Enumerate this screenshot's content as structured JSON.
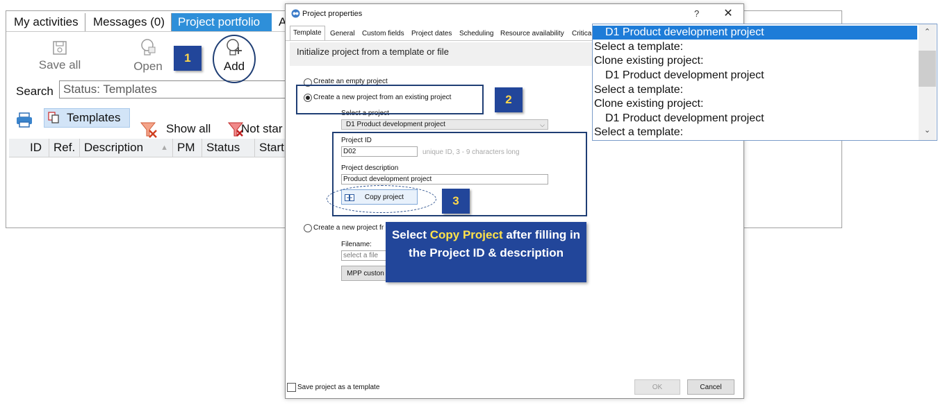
{
  "app": {
    "tabs": [
      "My activities",
      "Messages (0)",
      "Project portfolio",
      "A"
    ],
    "toolbar": {
      "save_all": "Save all",
      "open": "Open",
      "add": "Add"
    },
    "search": {
      "label": "Search",
      "value": "Status: Templates"
    },
    "filters": {
      "templates": "Templates",
      "show_all": "Show all",
      "not_started": "Not star"
    },
    "columns": [
      "ID",
      "Ref.",
      "Description",
      "PM",
      "Status",
      "Start"
    ]
  },
  "dialog": {
    "title": "Project properties",
    "help": "?",
    "close": "✕",
    "tabs": [
      "Template",
      "General",
      "Custom fields",
      "Project dates",
      "Scheduling",
      "Resource availability",
      "Critica"
    ],
    "section_title": "Initialize project from a template or file",
    "option_empty": "Create an empty project",
    "option_existing": "Create a new project from an existing project",
    "select_project_label": "Select a project",
    "select_project_value": "D1 Product development project",
    "project_id_label": "Project ID",
    "project_id_value": "D02",
    "project_id_hint": "unique ID, 3 - 9 characters long",
    "project_desc_label": "Project description",
    "project_desc_value": "Product development project",
    "copy_button": "Copy project",
    "option_file": "Create a new project fr",
    "filename_label": "Filename:",
    "filename_placeholder": "select a file",
    "mpp_button": "MPP custon",
    "save_template": "Save project as a template",
    "ok": "OK",
    "cancel": "Cancel"
  },
  "annotations": {
    "badge1": "1",
    "badge2": "2",
    "badge3": "3",
    "callout_pre": "Select ",
    "callout_highlight": "Copy Project",
    "callout_post": " after filling in the Project ID & description"
  },
  "dropdown": {
    "items": [
      "D1 Product development project",
      "Select a template:",
      "Clone existing project:",
      "D1 Product development project",
      "Select a template:",
      "Clone existing project:",
      "D1 Product development project",
      "Select a template:"
    ]
  },
  "colors": {
    "accent": "#2e8fd9",
    "annotation": "#22469a",
    "highlight": "#ffe24a",
    "selection": "#1e7cd8"
  }
}
